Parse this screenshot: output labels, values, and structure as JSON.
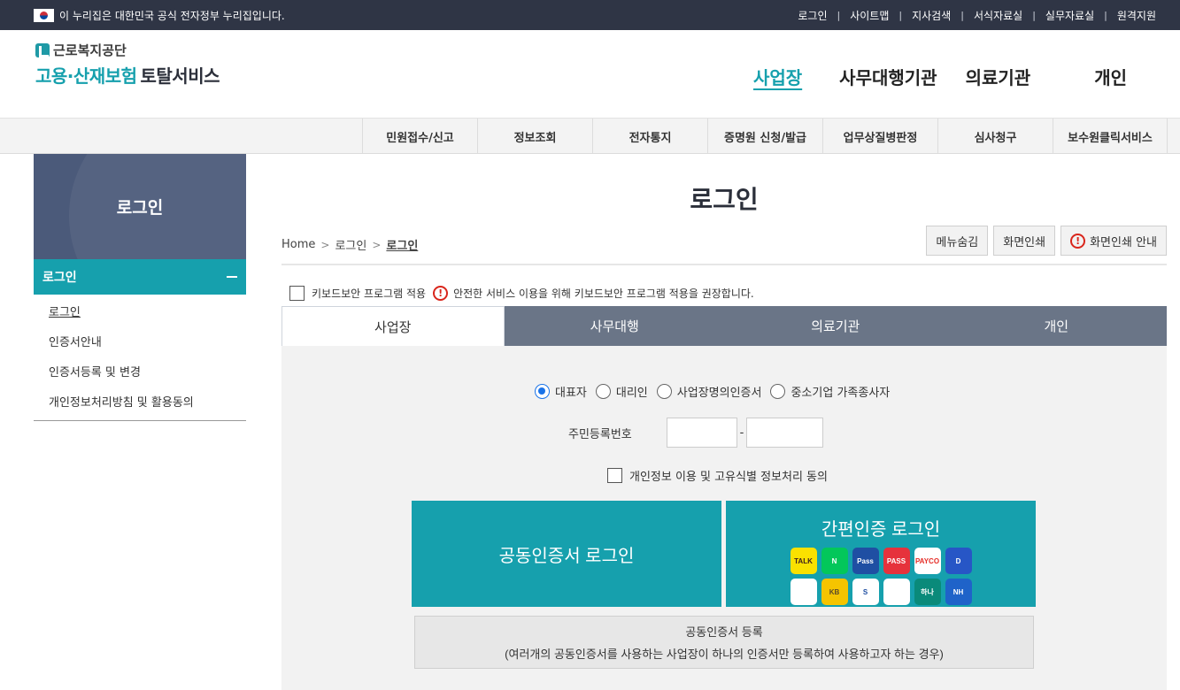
{
  "gov_bar": {
    "notice": "이 누리집은 대한민국 공식 전자정부 누리집입니다.",
    "links": [
      "로그인",
      "사이트맵",
      "지사검색",
      "서식자료실",
      "실무자료실",
      "원격지원"
    ]
  },
  "logo": {
    "org": "근로복지공단",
    "main_teal": "고용·산재보험",
    "main_dark": "토탈서비스"
  },
  "main_nav": [
    "사업장",
    "사무대행기관",
    "의료기관",
    "개인"
  ],
  "sub_nav": [
    "민원접수/신고",
    "정보조회",
    "전자통지",
    "증명원 신청/발급",
    "업무상질병판정",
    "심사청구",
    "보수원클릭서비스"
  ],
  "side": {
    "title": "로그인",
    "section": "로그인",
    "items": [
      "로그인",
      "인증서안내",
      "인증서등록 및 변경",
      "개인정보처리방침 및 활용동의"
    ]
  },
  "content": {
    "title": "로그인",
    "breadcrumb": [
      "Home",
      "로그인",
      "로그인"
    ],
    "tools": [
      "메뉴숨김",
      "화면인쇄",
      "화면인쇄 안내"
    ],
    "keyboard_label": "키보드보안 프로그램 적용",
    "keyboard_notice": "안전한 서비스 이용을 위해 키보드보안 프로그램 적용을 권장합니다.",
    "tabs": [
      "사업장",
      "사무대행",
      "의료기관",
      "개인"
    ],
    "radios": [
      "대표자",
      "대리인",
      "사업장명의인증서",
      "중소기업 가족종사자"
    ],
    "ssn_label": "주민등록번호",
    "ssn_dash": "-",
    "agree_label": "개인정보 이용 및 고유식별 정보처리 동의",
    "cert_login": "공동인증서 로그인",
    "simple_login": "간편인증 로그인",
    "simple_icons": [
      {
        "name": "kakao-icon",
        "label": "TALK",
        "bg": "#fae100",
        "fg": "#3c1e1e"
      },
      {
        "name": "naver-icon",
        "label": "N",
        "bg": "#03c75a",
        "fg": "#ffffff"
      },
      {
        "name": "samsung-pass-icon",
        "label": "Pass",
        "bg": "#1f4fa3",
        "fg": "#ffffff"
      },
      {
        "name": "pass-icon",
        "label": "PASS",
        "bg": "#e6323c",
        "fg": "#ffffff"
      },
      {
        "name": "payco-icon",
        "label": "PAYCO",
        "bg": "#ffffff",
        "fg": "#e52d27"
      },
      {
        "name": "dream-icon",
        "label": "D",
        "bg": "#2756c6",
        "fg": "#ffffff"
      },
      {
        "name": "toss-icon",
        "label": "",
        "bg": "#ffffff",
        "fg": "#1a80f0"
      },
      {
        "name": "kb-icon",
        "label": "KB",
        "bg": "#f5c400",
        "fg": "#5a4a2a"
      },
      {
        "name": "shinhan-icon",
        "label": "S",
        "bg": "#ffffff",
        "fg": "#1d4da1"
      },
      {
        "name": "bank-salad-icon",
        "label": "",
        "bg": "#ffffff",
        "fg": "#13b45a"
      },
      {
        "name": "hana-icon",
        "label": "하나",
        "bg": "#0a8a7a",
        "fg": "#ffffff"
      },
      {
        "name": "nh-icon",
        "label": "NH",
        "bg": "#1f63c9",
        "fg": "#ffffff"
      }
    ],
    "reg_title": "공동인증서 등록",
    "reg_desc": "(여러개의 공동인증서를 사용하는 사업장이 하나의 인증서만 등록하여 사용하고자 하는 경우)"
  },
  "colors": {
    "teal": "#16a0ad",
    "navy": "#2f3545",
    "side_head": "#4b5a7a",
    "tab_bg": "#6a7587"
  }
}
